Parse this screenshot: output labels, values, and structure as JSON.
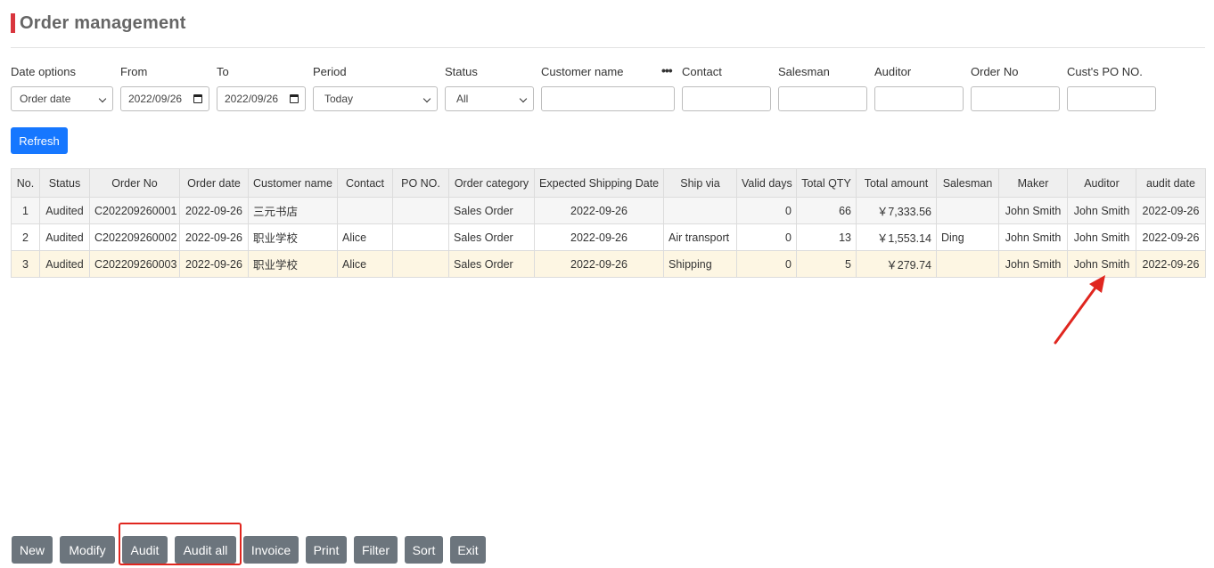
{
  "page": {
    "title": "Order management"
  },
  "filters": {
    "date_options": {
      "label": "Date options",
      "value": "Order date"
    },
    "from": {
      "label": "From",
      "value": "2022/09/26"
    },
    "to": {
      "label": "To",
      "value": "2022/09/26"
    },
    "period": {
      "label": "Period",
      "value": "Today"
    },
    "status": {
      "label": "Status",
      "value": "All"
    },
    "customer_name": {
      "label": "Customer name",
      "value": "",
      "more": "•••"
    },
    "contact": {
      "label": "Contact",
      "value": ""
    },
    "salesman": {
      "label": "Salesman",
      "value": ""
    },
    "auditor": {
      "label": "Auditor",
      "value": ""
    },
    "order_no": {
      "label": "Order No",
      "value": ""
    },
    "cust_po": {
      "label": "Cust's PO NO.",
      "value": ""
    }
  },
  "refresh_label": "Refresh",
  "table": {
    "headers": [
      "No.",
      "Status",
      "Order No",
      "Order date",
      "Customer name",
      "Contact",
      "PO NO.",
      "Order category",
      "Expected Shipping Date",
      "Ship via",
      "Valid days",
      "Total QTY",
      "Total amount",
      "Salesman",
      "Maker",
      "Auditor",
      "audit date"
    ],
    "rows": [
      [
        "1",
        "Audited",
        "C202209260001",
        "2022-09-26",
        "三元书店",
        "",
        "",
        "Sales Order",
        "2022-09-26",
        "",
        "0",
        "66",
        "￥7,333.56",
        "",
        "John Smith",
        "John Smith",
        "2022-09-26"
      ],
      [
        "2",
        "Audited",
        "C202209260002",
        "2022-09-26",
        "职业学校",
        "Alice",
        "",
        "Sales Order",
        "2022-09-26",
        "Air transport",
        "0",
        "13",
        "￥1,553.14",
        "Ding",
        "John Smith",
        "John Smith",
        "2022-09-26"
      ],
      [
        "3",
        "Audited",
        "C202209260003",
        "2022-09-26",
        "职业学校",
        "Alice",
        "",
        "Sales Order",
        "2022-09-26",
        "Shipping",
        "0",
        "5",
        "￥279.74",
        "",
        "John Smith",
        "John Smith",
        "2022-09-26"
      ]
    ]
  },
  "actions": {
    "new": "New",
    "modify": "Modify",
    "audit": "Audit",
    "audit_all": "Audit all",
    "invoice": "Invoice",
    "print": "Print",
    "filter": "Filter",
    "sort": "Sort",
    "exit": "Exit"
  },
  "colors": {
    "accent": "#d9363e",
    "primary_button": "#1677ff",
    "secondary_button": "#6c757d",
    "annotation": "#e0261f",
    "selected_row": "#fdf6e3"
  }
}
